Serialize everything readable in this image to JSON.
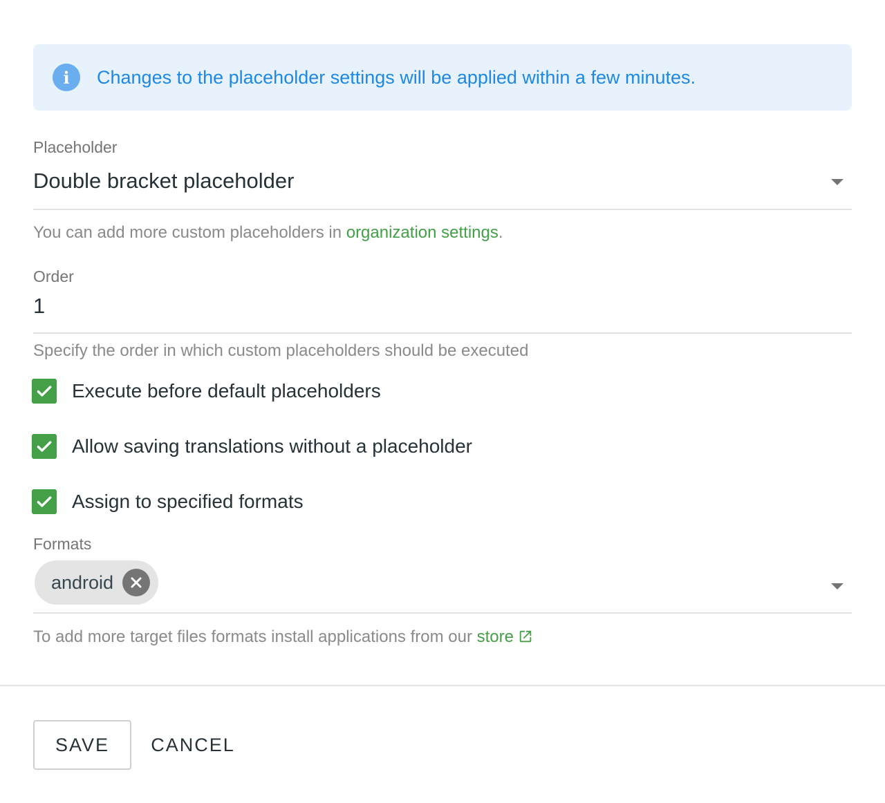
{
  "banner": {
    "icon": "info-icon",
    "icon_glyph": "i",
    "text": "Changes to the placeholder settings will be applied within a few minutes.",
    "color": "#1e88e5"
  },
  "placeholder_field": {
    "label": "Placeholder",
    "value": "Double bracket placeholder",
    "helper_prefix": "You can add more custom placeholders in ",
    "helper_link": "organization settings",
    "helper_suffix": "."
  },
  "order_field": {
    "label": "Order",
    "value": "1",
    "helper": "Specify the order in which custom placeholders should be executed"
  },
  "checkboxes": [
    {
      "label": "Execute before default placeholders",
      "checked": true
    },
    {
      "label": "Allow saving translations without a placeholder",
      "checked": true
    },
    {
      "label": "Assign to specified formats",
      "checked": true
    }
  ],
  "formats_field": {
    "label": "Formats",
    "chips": [
      "android"
    ],
    "helper_prefix": "To add more target files formats install applications from our ",
    "helper_link": "store"
  },
  "actions": {
    "save_label": "SAVE",
    "cancel_label": "CANCEL"
  },
  "colors": {
    "accent_green": "#43a047",
    "info_bg": "#e8f2fc"
  }
}
